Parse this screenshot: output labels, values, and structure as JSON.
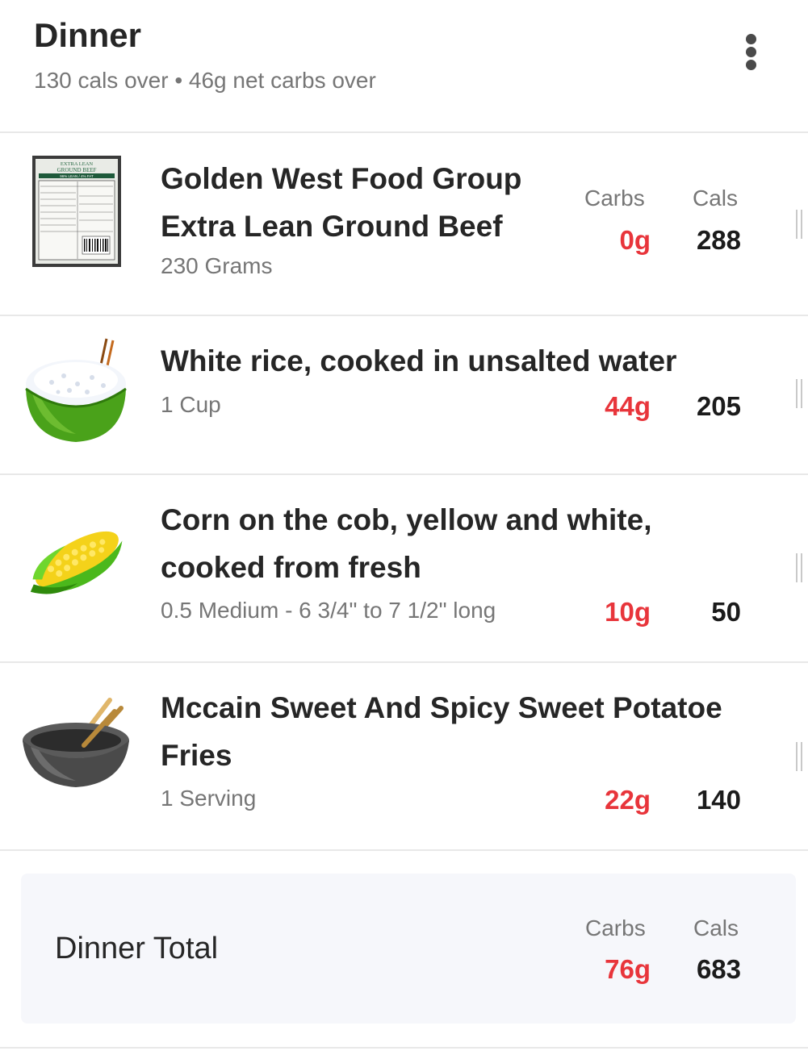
{
  "meal": {
    "title": "Dinner",
    "subtitle": "130 cals over • 46g net carbs over",
    "menu_icon": "more-vertical-icon"
  },
  "labels": {
    "carbs": "Carbs",
    "cals": "Cals"
  },
  "items": [
    {
      "name_line1": "Golden West Food Group",
      "name_line2": "Extra Lean Ground Beef",
      "serving": "230 Grams",
      "carbs": "0g",
      "cals": "288",
      "thumb_icon": "ground-beef-package-icon",
      "thumb_text_1": "EXTRA LEAN",
      "thumb_text_2": "GROUND BEEF",
      "thumb_text_3": "96% LEAN / 4% FAT"
    },
    {
      "name_line1": "White rice, cooked in unsalted water",
      "serving": "1 Cup",
      "carbs": "44g",
      "cals": "205",
      "thumb_icon": "rice-bowl-icon"
    },
    {
      "name_line1": "Corn on the cob, yellow and white,",
      "name_line2": "cooked from fresh",
      "serving": "0.5 Medium - 6 3/4\" to 7 1/2\" long",
      "carbs": "10g",
      "cals": "50",
      "thumb_icon": "corn-cob-icon"
    },
    {
      "name_line1": "Mccain Sweet And Spicy Sweet Potatoe",
      "name_line2": "Fries",
      "serving": "1 Serving",
      "carbs": "22g",
      "cals": "140",
      "thumb_icon": "empty-bowl-chopsticks-icon"
    }
  ],
  "total": {
    "label": "Dinner Total",
    "carbs": "76g",
    "cals": "683"
  },
  "colors": {
    "over_red": "#e8353b",
    "muted_text": "#767676",
    "total_bg": "#f6f7fb"
  }
}
